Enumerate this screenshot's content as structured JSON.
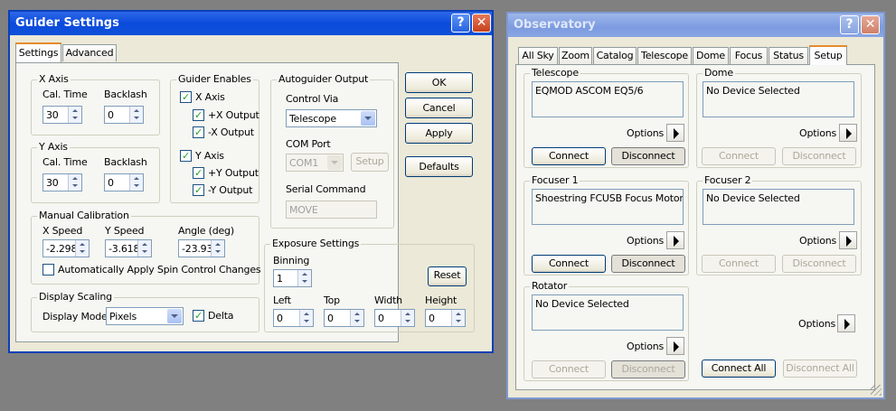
{
  "guider": {
    "title": "Guider Settings",
    "help_glyph": "?",
    "close_glyph": "✕",
    "tabs": [
      "Settings",
      "Advanced"
    ],
    "x_axis": {
      "legend": "X Axis",
      "cal_time_label": "Cal. Time",
      "backlash_label": "Backlash",
      "cal_time": "30",
      "backlash": "0"
    },
    "y_axis": {
      "legend": "Y Axis",
      "cal_time_label": "Cal. Time",
      "backlash_label": "Backlash",
      "cal_time": "30",
      "backlash": "0"
    },
    "enables": {
      "legend": "Guider Enables",
      "x_axis": "X Axis",
      "plus_x": "+X Output",
      "minus_x": "-X Output",
      "y_axis": "Y Axis",
      "plus_y": "+Y Output",
      "minus_y": "-Y Output",
      "check_glyph": "✓"
    },
    "output": {
      "legend": "Autoguider Output",
      "control_via_label": "Control Via",
      "control_via": "Telescope",
      "com_port_label": "COM Port",
      "com_port": "COM1",
      "setup": "Setup",
      "serial_label": "Serial Command",
      "serial_value": "MOVE"
    },
    "manual": {
      "legend": "Manual Calibration",
      "x_speed_label": "X Speed",
      "y_speed_label": "Y Speed",
      "angle_label": "Angle (deg)",
      "x_speed": "-2.298",
      "y_speed": "-3.618",
      "angle": "-23.93",
      "auto_apply": "Automatically Apply Spin Control Changes"
    },
    "exposure": {
      "legend": "Exposure Settings",
      "binning_label": "Binning",
      "binning": "1",
      "reset": "Reset",
      "left_label": "Left",
      "top_label": "Top",
      "width_label": "Width",
      "height_label": "Height",
      "left": "0",
      "top": "0",
      "width": "0",
      "height": "0"
    },
    "display": {
      "legend": "Display Scaling",
      "mode_label": "Display Mode",
      "mode": "Pixels",
      "delta": "Delta"
    },
    "buttons": {
      "ok": "OK",
      "cancel": "Cancel",
      "apply": "Apply",
      "defaults": "Defaults"
    }
  },
  "observatory": {
    "title": "Observatory",
    "help_glyph": "?",
    "close_glyph": "✕",
    "tabs": [
      "All Sky",
      "Zoom",
      "Catalog",
      "Telescope",
      "Dome",
      "Focus",
      "Status",
      "Setup"
    ],
    "connect": "Connect",
    "disconnect": "Disconnect",
    "options": "Options",
    "telescope": {
      "legend": "Telescope",
      "device": "EQMOD ASCOM EQ5/6"
    },
    "dome": {
      "legend": "Dome",
      "device": "No Device Selected"
    },
    "focuser1": {
      "legend": "Focuser 1",
      "device": "Shoestring FCUSB Focus Motor Co"
    },
    "focuser2": {
      "legend": "Focuser 2",
      "device": "No Device Selected"
    },
    "rotator": {
      "legend": "Rotator",
      "device": "No Device Selected"
    },
    "connect_all": "Connect All",
    "disconnect_all": "Disconnect All"
  }
}
